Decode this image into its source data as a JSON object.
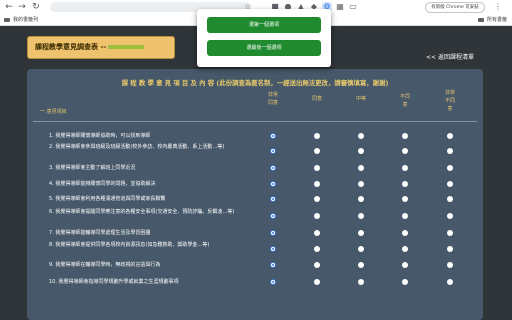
{
  "browser": {
    "bookmarks_label": "我的書籤列",
    "other_bookmarks_label": "所有書籤",
    "chrome_update_label": "有新版 Chrome 可安裝"
  },
  "page": {
    "title": "課程教學意見調查表 --",
    "back_link": "<< 返回課程清單",
    "panel_header": "課 程 教 學 意 見 項 目 及 內 容 (此份調查為匿名制，一經送出無法更改，請審慎填寫，謝謝)",
    "section_label": "一.意見項目",
    "columns": [
      {
        "label": "非常同意"
      },
      {
        "label": "同意"
      },
      {
        "label": "中等"
      },
      {
        "label": "不同意"
      },
      {
        "label": "非常不同意"
      }
    ],
    "questions": [
      {
        "text": "1. 我覺得導師關懷導師協助時，可以找到導師",
        "selected": 0
      },
      {
        "text": "2. 我覺得導師會參與班級及班級活動(校外參訪、校內慶典活動、系上活動…等)",
        "selected": 0
      },
      {
        "text": "3. 我覺得導師會主動了解班上同學近況",
        "selected": 0
      },
      {
        "text": "4. 我覺得導師能夠關懷同學的問題，並協助解決",
        "selected": 0
      },
      {
        "text": "5. 我覺得導師會利用各種溝通管道與同學或家長聯繫",
        "selected": 0
      },
      {
        "text": "6. 我覺得導師會提醒同學應注意的各種安全事項(交通安全、預防詐騙、反霸凌…等)",
        "selected": 0
      },
      {
        "text": "7. 我覺得導師能輔導同學處理生活及學習困擾",
        "selected": 0
      },
      {
        "text": "8. 我覺得導師會提供同學各項校內資源訊息(如急難救助、獎助學金…等)",
        "selected": 0
      },
      {
        "text": "9. 我覺得導師在輔導同學時，無歧視的言語與行為",
        "selected": 0
      },
      {
        "text": "10. 我覺得導師會指導同學規劃升學或就業之生涯規劃事項",
        "selected": 0
      }
    ]
  },
  "popup": {
    "button_select_first": "選第一個選項",
    "button_select_last": "選最後一個選項"
  }
}
